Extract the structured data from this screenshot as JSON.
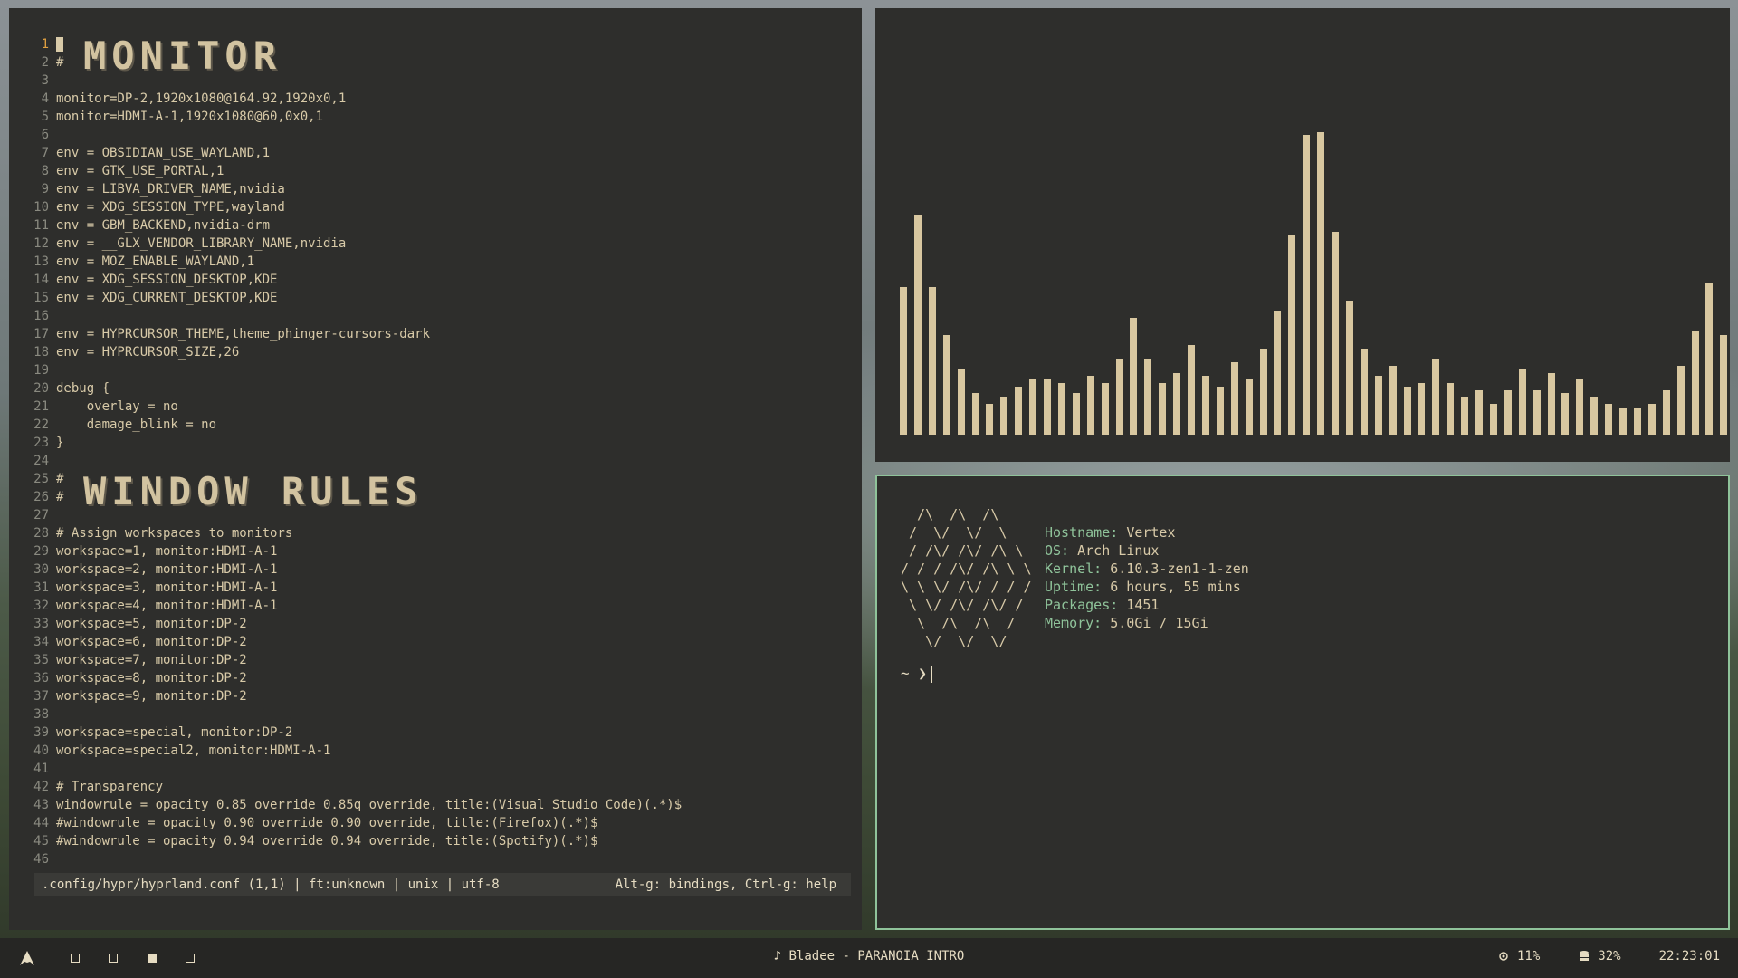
{
  "editor": {
    "title_monitor": "MONITOR",
    "title_window_rules": "WINDOW RULES",
    "lines": [
      {
        "n": "1",
        "t": "#",
        "current": true
      },
      {
        "n": "2",
        "t": "#"
      },
      {
        "n": "3",
        "t": ""
      },
      {
        "n": "4",
        "t": "monitor=DP-2,1920x1080@164.92,1920x0,1"
      },
      {
        "n": "5",
        "t": "monitor=HDMI-A-1,1920x1080@60,0x0,1"
      },
      {
        "n": "6",
        "t": ""
      },
      {
        "n": "7",
        "t": "env = OBSIDIAN_USE_WAYLAND,1"
      },
      {
        "n": "8",
        "t": "env = GTK_USE_PORTAL,1"
      },
      {
        "n": "9",
        "t": "env = LIBVA_DRIVER_NAME,nvidia"
      },
      {
        "n": "10",
        "t": "env = XDG_SESSION_TYPE,wayland"
      },
      {
        "n": "11",
        "t": "env = GBM_BACKEND,nvidia-drm"
      },
      {
        "n": "12",
        "t": "env = __GLX_VENDOR_LIBRARY_NAME,nvidia"
      },
      {
        "n": "13",
        "t": "env = MOZ_ENABLE_WAYLAND,1"
      },
      {
        "n": "14",
        "t": "env = XDG_SESSION_DESKTOP,KDE"
      },
      {
        "n": "15",
        "t": "env = XDG_CURRENT_DESKTOP,KDE"
      },
      {
        "n": "16",
        "t": ""
      },
      {
        "n": "17",
        "t": "env = HYPRCURSOR_THEME,theme_phinger-cursors-dark"
      },
      {
        "n": "18",
        "t": "env = HYPRCURSOR_SIZE,26"
      },
      {
        "n": "19",
        "t": ""
      },
      {
        "n": "20",
        "t": "debug {"
      },
      {
        "n": "21",
        "t": "    overlay = no"
      },
      {
        "n": "22",
        "t": "    damage_blink = no"
      },
      {
        "n": "23",
        "t": "}"
      },
      {
        "n": "24",
        "t": ""
      },
      {
        "n": "25",
        "t": "#"
      },
      {
        "n": "26",
        "t": "#"
      },
      {
        "n": "27",
        "t": ""
      },
      {
        "n": "28",
        "t": "# Assign workspaces to monitors"
      },
      {
        "n": "29",
        "t": "workspace=1, monitor:HDMI-A-1"
      },
      {
        "n": "30",
        "t": "workspace=2, monitor:HDMI-A-1"
      },
      {
        "n": "31",
        "t": "workspace=3, monitor:HDMI-A-1"
      },
      {
        "n": "32",
        "t": "workspace=4, monitor:HDMI-A-1"
      },
      {
        "n": "33",
        "t": "workspace=5, monitor:DP-2"
      },
      {
        "n": "34",
        "t": "workspace=6, monitor:DP-2"
      },
      {
        "n": "35",
        "t": "workspace=7, monitor:DP-2"
      },
      {
        "n": "36",
        "t": "workspace=8, monitor:DP-2"
      },
      {
        "n": "37",
        "t": "workspace=9, monitor:DP-2"
      },
      {
        "n": "38",
        "t": ""
      },
      {
        "n": "39",
        "t": "workspace=special, monitor:DP-2"
      },
      {
        "n": "40",
        "t": "workspace=special2, monitor:HDMI-A-1"
      },
      {
        "n": "41",
        "t": ""
      },
      {
        "n": "42",
        "t": "# Transparency"
      },
      {
        "n": "43",
        "t": "windowrule = opacity 0.85 override 0.85q override, title:(Visual Studio Code)(.*)$"
      },
      {
        "n": "44",
        "t": "#windowrule = opacity 0.90 override 0.90 override, title:(Firefox)(.*)$"
      },
      {
        "n": "45",
        "t": "#windowrule = opacity 0.94 override 0.94 override, title:(Spotify)(.*)$"
      },
      {
        "n": "46",
        "t": ""
      }
    ],
    "status_left": ".config/hypr/hyprland.conf (1,1) | ft:unknown | unix | utf-8",
    "status_right": "Alt-g: bindings, Ctrl-g: help"
  },
  "visualizer": {
    "levels": [
      0.43,
      0.64,
      0.43,
      0.29,
      0.19,
      0.12,
      0.09,
      0.11,
      0.14,
      0.16,
      0.16,
      0.15,
      0.12,
      0.17,
      0.15,
      0.22,
      0.34,
      0.22,
      0.15,
      0.18,
      0.26,
      0.17,
      0.14,
      0.21,
      0.16,
      0.25,
      0.36,
      0.58,
      0.87,
      0.88,
      0.59,
      0.39,
      0.25,
      0.17,
      0.2,
      0.14,
      0.15,
      0.22,
      0.15,
      0.11,
      0.13,
      0.09,
      0.13,
      0.19,
      0.13,
      0.18,
      0.12,
      0.16,
      0.11,
      0.09,
      0.08,
      0.08,
      0.09,
      0.13,
      0.2,
      0.3,
      0.44,
      0.29
    ]
  },
  "terminal": {
    "ascii_art": "  /\\  /\\  /\\\n /  \\/  \\/  \\\n / /\\/ /\\/ /\\ \\\n/ / / /\\/ /\\ \\ \\\n\\ \\ \\/ /\\/ / / /\n \\ \\/ /\\/ /\\/ /\n  \\  /\\  /\\  /\n   \\/  \\/  \\/",
    "info": [
      {
        "key": "Hostname:",
        "value": "Vertex"
      },
      {
        "key": "OS:",
        "value": "Arch Linux"
      },
      {
        "key": "Kernel:",
        "value": "6.10.3-zen1-1-zen"
      },
      {
        "key": "Uptime:",
        "value": "6 hours, 55 mins"
      },
      {
        "key": "Packages:",
        "value": "1451"
      },
      {
        "key": "Memory:",
        "value": "5.0Gi / 15Gi"
      }
    ],
    "prompt": "~ ❯"
  },
  "taskbar": {
    "now_playing": "♪ Bladee - PARANOIA INTRO",
    "cpu": "11%",
    "disk": "32%",
    "clock": "22:23:01",
    "workspaces": [
      {
        "label": "1",
        "active": false
      },
      {
        "label": "2",
        "active": false
      },
      {
        "label": "3",
        "active": true
      },
      {
        "label": "4",
        "active": false
      }
    ]
  },
  "colors": {
    "accent": "#8fc39a",
    "text": "#d8caa8",
    "bar": "#d8c7a0",
    "window_bg": "#2e2e2c"
  }
}
